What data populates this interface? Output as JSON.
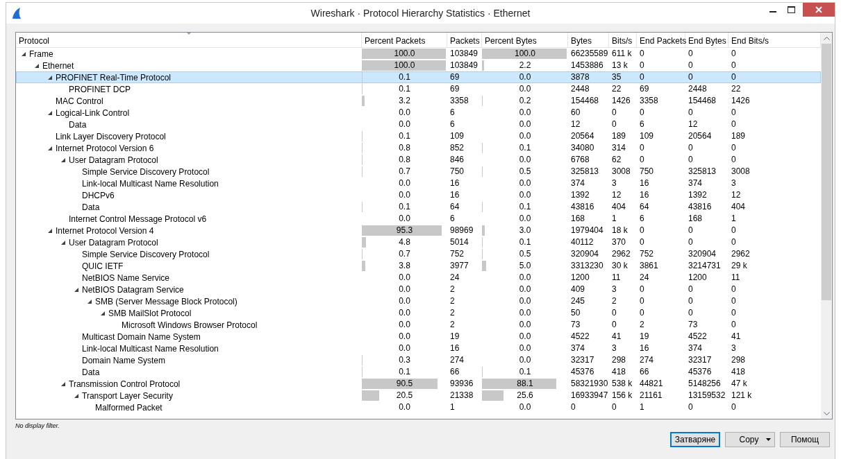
{
  "window": {
    "title": "Wireshark · Protocol Hierarchy Statistics · Ethernet"
  },
  "table": {
    "columns": [
      "Protocol",
      "Percent Packets",
      "Packets",
      "Percent Bytes",
      "Bytes",
      "Bits/s",
      "End Packets",
      "End Bytes",
      "End Bits/s"
    ],
    "rows": [
      {
        "protocol": "Frame",
        "expanded": true,
        "selected": false,
        "percent_packets": "100.0",
        "packets": "103849",
        "percent_bytes": "100.0",
        "bytes": "66235589",
        "bits_s": "611 k",
        "end_packets": "0",
        "end_bytes": "0",
        "end_bits_s": "0",
        "children": [
          {
            "protocol": "Ethernet",
            "expanded": true,
            "selected": false,
            "percent_packets": "100.0",
            "packets": "103849",
            "percent_bytes": "2.2",
            "bytes": "1453886",
            "bits_s": "13 k",
            "end_packets": "0",
            "end_bytes": "0",
            "end_bits_s": "0",
            "children": [
              {
                "protocol": "PROFINET Real-Time Protocol",
                "expanded": true,
                "selected": true,
                "percent_packets": "0.1",
                "packets": "69",
                "percent_bytes": "0.0",
                "bytes": "3878",
                "bits_s": "35",
                "end_packets": "0",
                "end_bytes": "0",
                "end_bits_s": "0",
                "children": [
                  {
                    "protocol": "PROFINET DCP",
                    "selected": false,
                    "percent_packets": "0.1",
                    "packets": "69",
                    "percent_bytes": "0.0",
                    "bytes": "2448",
                    "bits_s": "22",
                    "end_packets": "69",
                    "end_bytes": "2448",
                    "end_bits_s": "22"
                  }
                ]
              },
              {
                "protocol": "MAC Control",
                "selected": false,
                "percent_packets": "3.2",
                "packets": "3358",
                "percent_bytes": "0.2",
                "bytes": "154468",
                "bits_s": "1426",
                "end_packets": "3358",
                "end_bytes": "154468",
                "end_bits_s": "1426"
              },
              {
                "protocol": "Logical-Link Control",
                "expanded": true,
                "selected": false,
                "percent_packets": "0.0",
                "packets": "6",
                "percent_bytes": "0.0",
                "bytes": "60",
                "bits_s": "0",
                "end_packets": "0",
                "end_bytes": "0",
                "end_bits_s": "0",
                "children": [
                  {
                    "protocol": "Data",
                    "selected": false,
                    "percent_packets": "0.0",
                    "packets": "6",
                    "percent_bytes": "0.0",
                    "bytes": "12",
                    "bits_s": "0",
                    "end_packets": "6",
                    "end_bytes": "12",
                    "end_bits_s": "0"
                  }
                ]
              },
              {
                "protocol": "Link Layer Discovery Protocol",
                "selected": false,
                "percent_packets": "0.1",
                "packets": "109",
                "percent_bytes": "0.0",
                "bytes": "20564",
                "bits_s": "189",
                "end_packets": "109",
                "end_bytes": "20564",
                "end_bits_s": "189"
              },
              {
                "protocol": "Internet Protocol Version 6",
                "expanded": true,
                "selected": false,
                "percent_packets": "0.8",
                "packets": "852",
                "percent_bytes": "0.1",
                "bytes": "34080",
                "bits_s": "314",
                "end_packets": "0",
                "end_bytes": "0",
                "end_bits_s": "0",
                "children": [
                  {
                    "protocol": "User Datagram Protocol",
                    "expanded": true,
                    "selected": false,
                    "percent_packets": "0.8",
                    "packets": "846",
                    "percent_bytes": "0.0",
                    "bytes": "6768",
                    "bits_s": "62",
                    "end_packets": "0",
                    "end_bytes": "0",
                    "end_bits_s": "0",
                    "children": [
                      {
                        "protocol": "Simple Service Discovery Protocol",
                        "selected": false,
                        "percent_packets": "0.7",
                        "packets": "750",
                        "percent_bytes": "0.5",
                        "bytes": "325813",
                        "bits_s": "3008",
                        "end_packets": "750",
                        "end_bytes": "325813",
                        "end_bits_s": "3008"
                      },
                      {
                        "protocol": "Link-local Multicast Name Resolution",
                        "selected": false,
                        "percent_packets": "0.0",
                        "packets": "16",
                        "percent_bytes": "0.0",
                        "bytes": "374",
                        "bits_s": "3",
                        "end_packets": "16",
                        "end_bytes": "374",
                        "end_bits_s": "3"
                      },
                      {
                        "protocol": "DHCPv6",
                        "selected": false,
                        "percent_packets": "0.0",
                        "packets": "16",
                        "percent_bytes": "0.0",
                        "bytes": "1392",
                        "bits_s": "12",
                        "end_packets": "16",
                        "end_bytes": "1392",
                        "end_bits_s": "12"
                      },
                      {
                        "protocol": "Data",
                        "selected": false,
                        "percent_packets": "0.1",
                        "packets": "64",
                        "percent_bytes": "0.1",
                        "bytes": "43816",
                        "bits_s": "404",
                        "end_packets": "64",
                        "end_bytes": "43816",
                        "end_bits_s": "404"
                      }
                    ]
                  },
                  {
                    "protocol": "Internet Control Message Protocol v6",
                    "selected": false,
                    "percent_packets": "0.0",
                    "packets": "6",
                    "percent_bytes": "0.0",
                    "bytes": "168",
                    "bits_s": "1",
                    "end_packets": "6",
                    "end_bytes": "168",
                    "end_bits_s": "1"
                  }
                ]
              },
              {
                "protocol": "Internet Protocol Version 4",
                "expanded": true,
                "selected": false,
                "percent_packets": "95.3",
                "packets": "98969",
                "percent_bytes": "3.0",
                "bytes": "1979404",
                "bits_s": "18 k",
                "end_packets": "0",
                "end_bytes": "0",
                "end_bits_s": "0",
                "children": [
                  {
                    "protocol": "User Datagram Protocol",
                    "expanded": true,
                    "selected": false,
                    "percent_packets": "4.8",
                    "packets": "5014",
                    "percent_bytes": "0.1",
                    "bytes": "40112",
                    "bits_s": "370",
                    "end_packets": "0",
                    "end_bytes": "0",
                    "end_bits_s": "0",
                    "children": [
                      {
                        "protocol": "Simple Service Discovery Protocol",
                        "selected": false,
                        "percent_packets": "0.7",
                        "packets": "752",
                        "percent_bytes": "0.5",
                        "bytes": "320904",
                        "bits_s": "2962",
                        "end_packets": "752",
                        "end_bytes": "320904",
                        "end_bits_s": "2962"
                      },
                      {
                        "protocol": "QUIC IETF",
                        "selected": false,
                        "percent_packets": "3.8",
                        "packets": "3977",
                        "percent_bytes": "5.0",
                        "bytes": "3313230",
                        "bits_s": "30 k",
                        "end_packets": "3861",
                        "end_bytes": "3214731",
                        "end_bits_s": "29 k"
                      },
                      {
                        "protocol": "NetBIOS Name Service",
                        "selected": false,
                        "percent_packets": "0.0",
                        "packets": "24",
                        "percent_bytes": "0.0",
                        "bytes": "1200",
                        "bits_s": "11",
                        "end_packets": "24",
                        "end_bytes": "1200",
                        "end_bits_s": "11"
                      },
                      {
                        "protocol": "NetBIOS Datagram Service",
                        "expanded": true,
                        "selected": false,
                        "percent_packets": "0.0",
                        "packets": "2",
                        "percent_bytes": "0.0",
                        "bytes": "409",
                        "bits_s": "3",
                        "end_packets": "0",
                        "end_bytes": "0",
                        "end_bits_s": "0",
                        "children": [
                          {
                            "protocol": "SMB (Server Message Block Protocol)",
                            "expanded": true,
                            "selected": false,
                            "percent_packets": "0.0",
                            "packets": "2",
                            "percent_bytes": "0.0",
                            "bytes": "245",
                            "bits_s": "2",
                            "end_packets": "0",
                            "end_bytes": "0",
                            "end_bits_s": "0",
                            "children": [
                              {
                                "protocol": "SMB MailSlot Protocol",
                                "expanded": true,
                                "selected": false,
                                "percent_packets": "0.0",
                                "packets": "2",
                                "percent_bytes": "0.0",
                                "bytes": "50",
                                "bits_s": "0",
                                "end_packets": "0",
                                "end_bytes": "0",
                                "end_bits_s": "0",
                                "children": [
                                  {
                                    "protocol": "Microsoft Windows Browser Protocol",
                                    "selected": false,
                                    "percent_packets": "0.0",
                                    "packets": "2",
                                    "percent_bytes": "0.0",
                                    "bytes": "73",
                                    "bits_s": "0",
                                    "end_packets": "2",
                                    "end_bytes": "73",
                                    "end_bits_s": "0"
                                  }
                                ]
                              }
                            ]
                          }
                        ]
                      },
                      {
                        "protocol": "Multicast Domain Name System",
                        "selected": false,
                        "percent_packets": "0.0",
                        "packets": "19",
                        "percent_bytes": "0.0",
                        "bytes": "4522",
                        "bits_s": "41",
                        "end_packets": "19",
                        "end_bytes": "4522",
                        "end_bits_s": "41"
                      },
                      {
                        "protocol": "Link-local Multicast Name Resolution",
                        "selected": false,
                        "percent_packets": "0.0",
                        "packets": "16",
                        "percent_bytes": "0.0",
                        "bytes": "374",
                        "bits_s": "3",
                        "end_packets": "16",
                        "end_bytes": "374",
                        "end_bits_s": "3"
                      },
                      {
                        "protocol": "Domain Name System",
                        "selected": false,
                        "percent_packets": "0.3",
                        "packets": "274",
                        "percent_bytes": "0.0",
                        "bytes": "32317",
                        "bits_s": "298",
                        "end_packets": "274",
                        "end_bytes": "32317",
                        "end_bits_s": "298"
                      },
                      {
                        "protocol": "Data",
                        "selected": false,
                        "percent_packets": "0.1",
                        "packets": "66",
                        "percent_bytes": "0.1",
                        "bytes": "45376",
                        "bits_s": "418",
                        "end_packets": "66",
                        "end_bytes": "45376",
                        "end_bits_s": "418"
                      }
                    ]
                  },
                  {
                    "protocol": "Transmission Control Protocol",
                    "expanded": true,
                    "selected": false,
                    "percent_packets": "90.5",
                    "packets": "93936",
                    "percent_bytes": "88.1",
                    "bytes": "58321930",
                    "bits_s": "538 k",
                    "end_packets": "44821",
                    "end_bytes": "5148256",
                    "end_bits_s": "47 k",
                    "children": [
                      {
                        "protocol": "Transport Layer Security",
                        "expanded": true,
                        "selected": false,
                        "percent_packets": "20.5",
                        "packets": "21338",
                        "percent_bytes": "25.6",
                        "bytes": "16933947",
                        "bits_s": "156 k",
                        "end_packets": "21161",
                        "end_bytes": "13159532",
                        "end_bits_s": "121 k",
                        "children": [
                          {
                            "protocol": "Malformed Packet",
                            "selected": false,
                            "percent_packets": "0.0",
                            "packets": "1",
                            "percent_bytes": "0.0",
                            "bytes": "0",
                            "bits_s": "0",
                            "end_packets": "1",
                            "end_bytes": "0",
                            "end_bits_s": "0"
                          }
                        ]
                      }
                    ]
                  }
                ]
              }
            ]
          }
        ]
      }
    ]
  },
  "status": "No display filter.",
  "buttons": [
    {
      "label": "Затваряне",
      "kind": "default"
    },
    {
      "label": "Copy",
      "kind": "menu"
    },
    {
      "label": "Помощ",
      "kind": "plain"
    }
  ]
}
